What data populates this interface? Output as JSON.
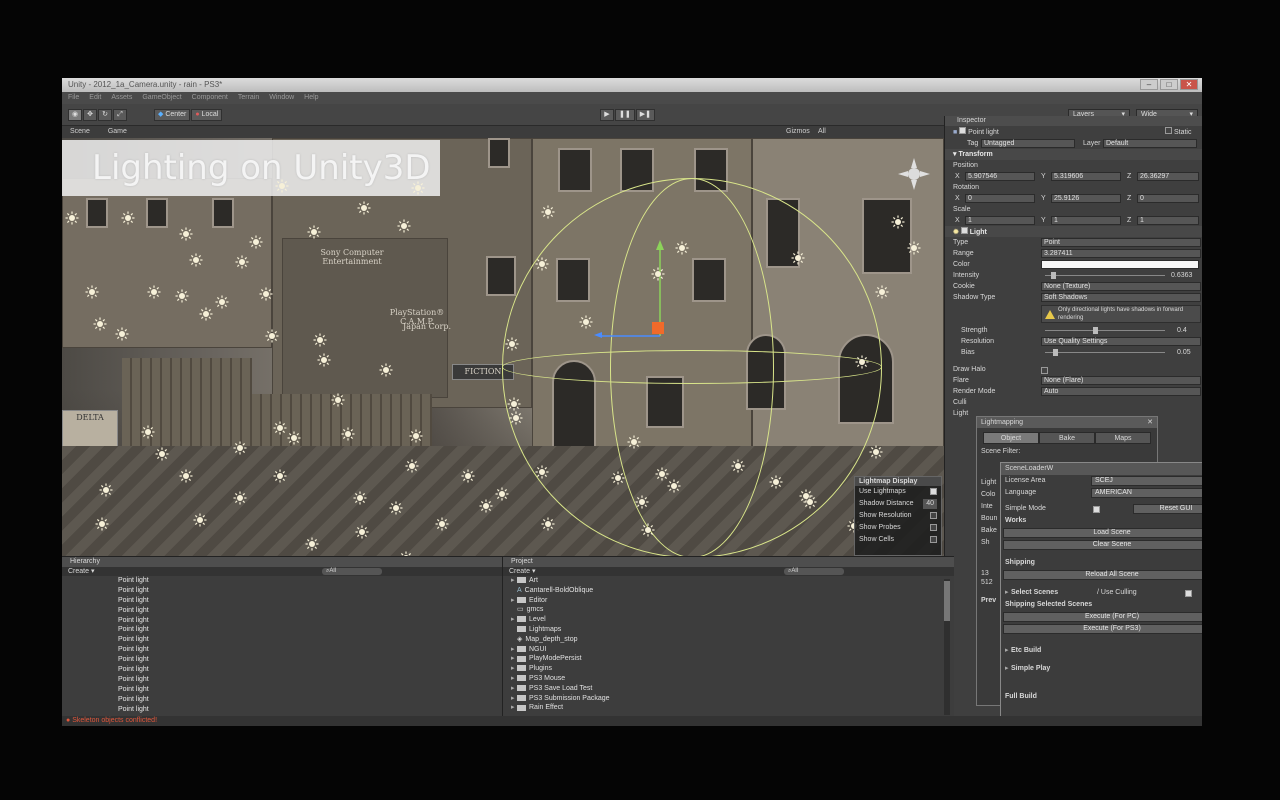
{
  "window": {
    "title": "Unity - 2012_1a_Camera.unity - rain - PS3*"
  },
  "menu": [
    "File",
    "Edit",
    "Assets",
    "GameObject",
    "Component",
    "Terrain",
    "Window",
    "Help"
  ],
  "toolbar": {
    "pivot_label": "Center",
    "space_label": "Local",
    "play_icons": [
      "play-icon",
      "pause-icon",
      "step-icon"
    ],
    "layers_label": "Layers",
    "layout_label": "Wide"
  },
  "scene": {
    "tabs": [
      "Scene",
      "Game"
    ],
    "gizmos_label": "Gizmos",
    "search_label": "All",
    "overlay_title": "Lighting on Unity3D",
    "signs": {
      "sony": "Sony Computer Entertainment",
      "playstation": "PlayStation® C.A.M.P.",
      "corp": "Japan Corp.",
      "fiction": "FICTION",
      "delta": "DELTA"
    },
    "lightmap_display": {
      "title": "Lightmap Display",
      "rows": [
        {
          "label": "Use Lightmaps",
          "value": "",
          "checked": true
        },
        {
          "label": "Shadow Distance",
          "value": "40",
          "checked": null
        },
        {
          "label": "Show Resolution",
          "value": "",
          "checked": false
        },
        {
          "label": "Show Probes",
          "value": "",
          "checked": false
        },
        {
          "label": "Show Cells",
          "value": "",
          "checked": false
        }
      ]
    }
  },
  "inspector": {
    "tab": "Inspector",
    "object_name": "Point light",
    "static_label": "Static",
    "tag_label": "Tag",
    "tag_value": "Untagged",
    "layer_label": "Layer",
    "layer_value": "Default",
    "transform": {
      "title": "Transform",
      "position_label": "Position",
      "position": {
        "x": "5.907546",
        "y": "5.319606",
        "z": "26.36297"
      },
      "rotation_label": "Rotation",
      "rotation": {
        "x": "0",
        "y": "25.9126",
        "z": "0"
      },
      "scale_label": "Scale",
      "scale": {
        "x": "1",
        "y": "1",
        "z": "1"
      }
    },
    "light": {
      "title": "Light",
      "type_label": "Type",
      "type_value": "Point",
      "range_label": "Range",
      "range_value": "3.287411",
      "color_label": "Color",
      "intensity_label": "Intensity",
      "intensity_value": "0.6363",
      "cookie_label": "Cookie",
      "cookie_value": "None (Texture)",
      "shadow_type_label": "Shadow Type",
      "shadow_type_value": "Soft Shadows",
      "warning": "Only directional lights have shadows in forward rendering",
      "strength_label": "Strength",
      "strength_value": "0.4",
      "resolution_label": "Resolution",
      "resolution_value": "Use Quality Settings",
      "bias_label": "Bias",
      "bias_value": "0.05",
      "draw_halo_label": "Draw Halo",
      "flare_label": "Flare",
      "flare_value": "None (Flare)",
      "render_mode_label": "Render Mode",
      "render_mode_value": "Auto",
      "culling_label": "Culli",
      "lightmapping_label": "Light"
    }
  },
  "lightmapping": {
    "title": "Lightmapping",
    "tabs": [
      "Object",
      "Bake",
      "Maps"
    ],
    "scene_filter_label": "Scene Filter:",
    "partial_labels": [
      "Light",
      "Colo",
      "Inte",
      "Boun",
      "Bake",
      "Sh"
    ],
    "stats": [
      "13",
      "512"
    ],
    "preview_label": "Prev"
  },
  "scene_loader": {
    "title": "SceneLoaderW",
    "license_area_label": "License Area",
    "license_area_value": "SCEJ",
    "language_label": "Language",
    "language_value": "AMERICAN",
    "simple_mode_label": "Simple Mode",
    "reset_gui_label": "Reset GUI",
    "works_label": "Works",
    "load_scene_label": "Load Scene",
    "clear_scene_label": "Clear Scene",
    "shipping_label": "Shipping",
    "reload_all_label": "Reload All Scene",
    "select_scenes_label": "Select Scenes",
    "use_culling_label": "/ Use Culling",
    "shipping_selected_label": "Shipping Selected Scenes",
    "execute_pc_label": "Execute (For PC)",
    "execute_ps3_label": "Execute (For PS3)",
    "etc_build_label": "Etc Build",
    "simple_play_label": "Simple Play",
    "full_build_label": "Full Build"
  },
  "hierarchy": {
    "tab": "Hierarchy",
    "create_label": "Create",
    "search_label": "All",
    "items": [
      "Point light",
      "Point light",
      "Point light",
      "Point light",
      "Point light",
      "Point light",
      "Point light",
      "Point light",
      "Point light",
      "Point light",
      "Point light",
      "Point light",
      "Point light",
      "Point light"
    ]
  },
  "project": {
    "tab": "Project",
    "create_label": "Create",
    "search_label": "All",
    "items": [
      {
        "name": "Art",
        "kind": "folder",
        "expand": true
      },
      {
        "name": "Cantarell-BoldOblique",
        "kind": "font",
        "expand": false
      },
      {
        "name": "Editor",
        "kind": "folder",
        "expand": true
      },
      {
        "name": "gmcs",
        "kind": "file",
        "expand": false
      },
      {
        "name": "Level",
        "kind": "folder",
        "expand": true
      },
      {
        "name": "Lightmaps",
        "kind": "folder",
        "expand": false
      },
      {
        "name": "Map_depth_stop",
        "kind": "scene",
        "expand": false
      },
      {
        "name": "NGUI",
        "kind": "folder",
        "expand": true
      },
      {
        "name": "PlayModePersist",
        "kind": "folder",
        "expand": true
      },
      {
        "name": "Plugins",
        "kind": "folder",
        "expand": true
      },
      {
        "name": "PS3 Mouse",
        "kind": "folder",
        "expand": true
      },
      {
        "name": "PS3 Save Load Test",
        "kind": "folder",
        "expand": true
      },
      {
        "name": "PS3 Submission Package",
        "kind": "folder",
        "expand": true
      },
      {
        "name": "Rain Effect",
        "kind": "folder",
        "expand": true
      }
    ]
  },
  "status": {
    "message": "Skeleton objects conflicted!"
  },
  "colors": {
    "accent_sun": "#f6f0d8",
    "gizmo": "#d9e58a",
    "error": "#e0573c",
    "warn": "#e7c84a"
  }
}
